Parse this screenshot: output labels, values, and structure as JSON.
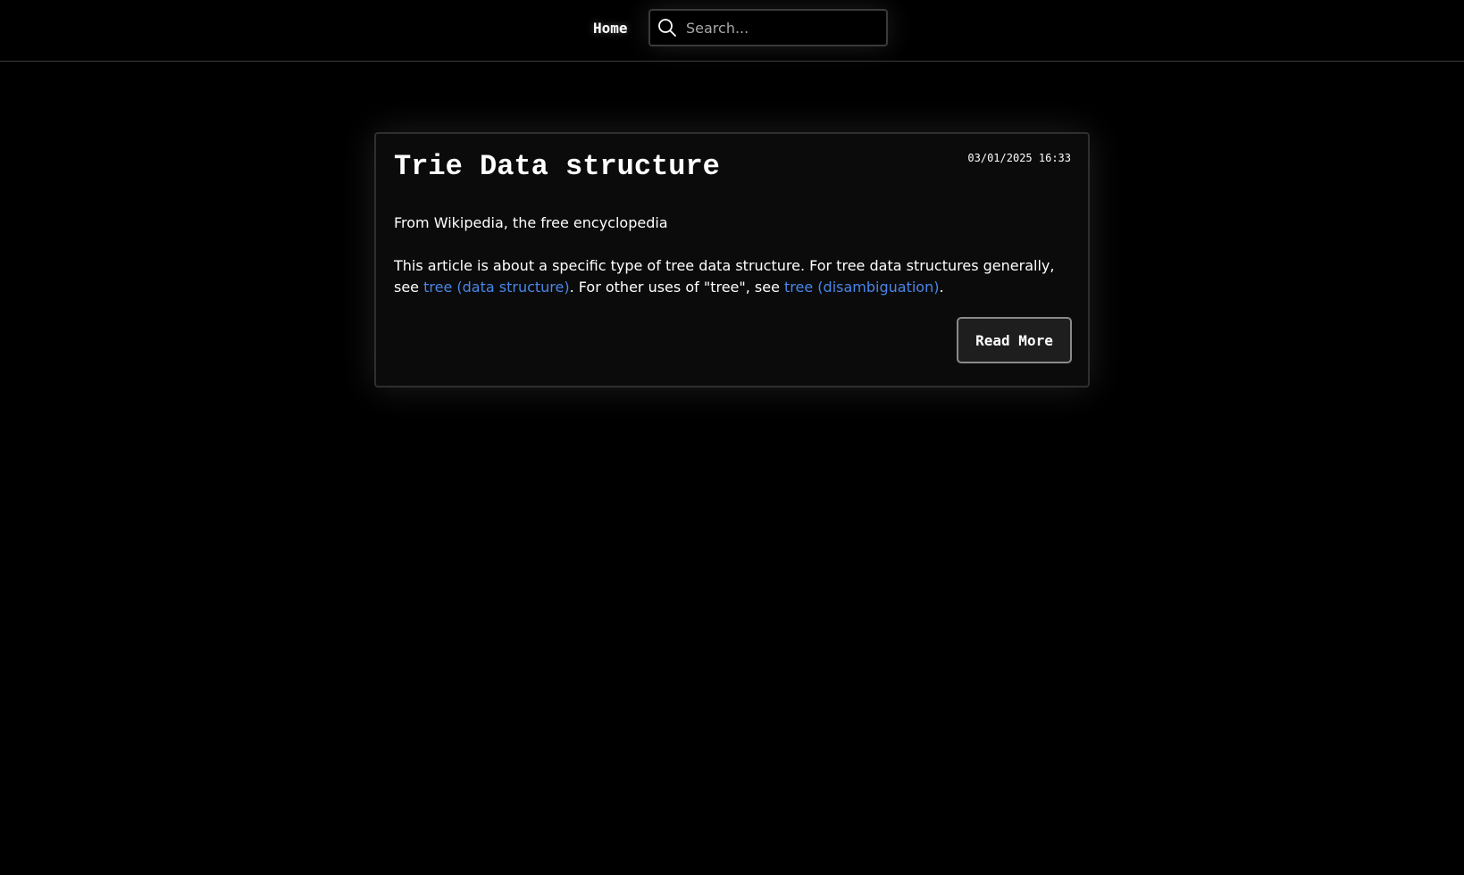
{
  "nav": {
    "home_label": "Home"
  },
  "search": {
    "placeholder": "Search...",
    "value": "",
    "icon": "search-icon"
  },
  "post": {
    "title": "Trie Data structure",
    "date": "03/01/2025 16:33",
    "intro": "From Wikipedia, the free encyclopedia",
    "hatnote_part1": "This article is about a specific type of tree data structure. For tree data structures generally, see ",
    "link1_label": "tree (data structure)",
    "hatnote_part2": ". For other uses of \"tree\", see ",
    "link2_label": "tree (disambiguation)",
    "hatnote_part3": ".",
    "read_more_label": "Read More"
  },
  "colors": {
    "background": "#000000",
    "card_background": "#0b0b0b",
    "link": "#4a86e8",
    "text": "#ffffff"
  }
}
